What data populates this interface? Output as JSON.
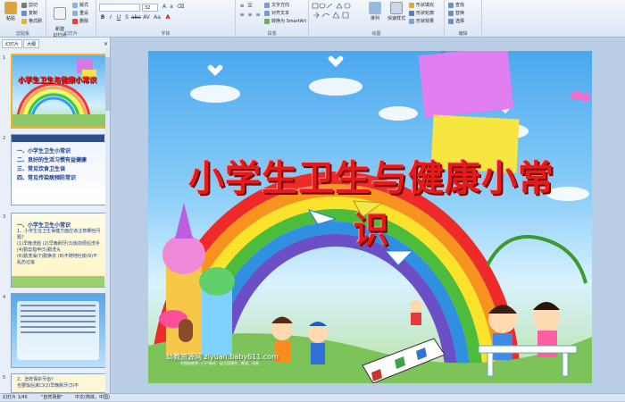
{
  "ribbon": {
    "clipboard": {
      "label": "剪贴板",
      "paste": "粘贴",
      "cut": "剪切",
      "copy": "复制",
      "format_painter": "格式刷"
    },
    "slides": {
      "label": "幻灯片",
      "new_slide": "新建\n幻灯片",
      "layout": "版式",
      "reset": "重设",
      "delete": "删除"
    },
    "font": {
      "label": "字体",
      "font_value": "",
      "size_value": "32"
    },
    "paragraph": {
      "label": "段落",
      "text_direction": "文字方向",
      "align_text": "对齐文本",
      "smartart": "转换为 SmartArt"
    },
    "drawing": {
      "label": "绘图",
      "arrange": "排列",
      "quick_styles": "快速样式",
      "shape_fill": "形状填充",
      "shape_outline": "形状轮廓",
      "shape_effects": "形状效果"
    },
    "editing": {
      "label": "编辑",
      "find": "查找",
      "replace": "替换",
      "select": "选择"
    }
  },
  "panel": {
    "tabs": [
      "幻灯片",
      "大纲"
    ],
    "close": "×",
    "slide_numbers": [
      "1",
      "2",
      "3",
      "4",
      "5"
    ],
    "thumb1_title": "小学生卫生与健康小常识",
    "thumb2_lines": [
      "一、小学生卫生小常识",
      "二、良好的生活习惯有益健康",
      "三、常见饮食卫生误",
      "四、常见传染病预防常识"
    ],
    "thumb3_lines": [
      "一、小学生卫生小常识",
      "1、小学生在卫生保健方面应该注意哪些问题?",
      "(1)早晚洗脸 (2)早晚刷牙(3)饭前便后洗手 (4)勤剪指甲(5)勤洗头",
      "(6)勤洗澡(7)勤换衣 (8)不随地吐痰(9)不乱扔垃圾"
    ],
    "thumb5_lines": [
      "2、怎样保护牙齿?",
      "也要饭后漱口(2)早晚刷牙(3)不"
    ]
  },
  "slide": {
    "title": "小学生卫生与健康小常识",
    "watermark": "幼教资源网 ziyuan.baby611.com",
    "watermark_sub": "中国幼教第一门户网站 - 幼儿园课件、教案、试卷",
    "notes_label": ""
  },
  "status": {
    "slide_info": "幻灯片 1/45",
    "theme": "\"自然场景\"",
    "lang": "中文(简体，中国)"
  },
  "colors": {
    "accent": "#f0b32a",
    "title_red": "#e41b1b",
    "ribbon": "#dce7f5"
  }
}
